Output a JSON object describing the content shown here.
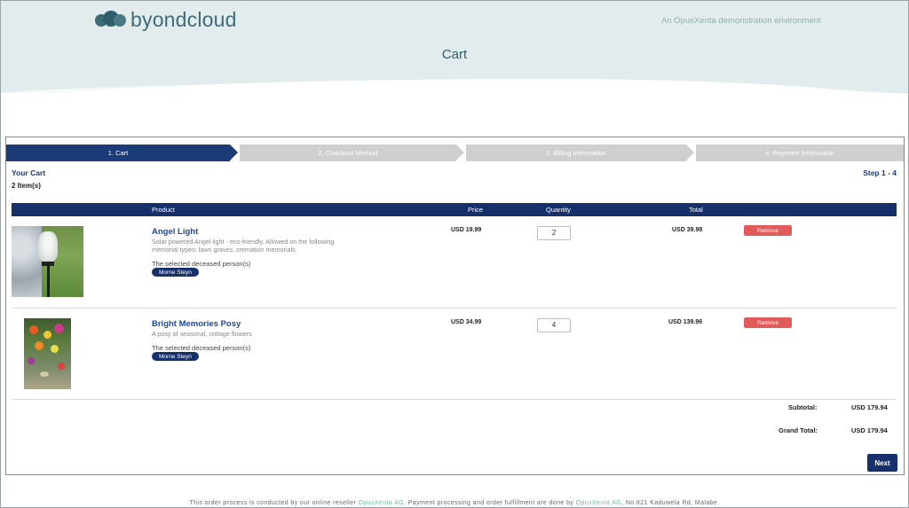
{
  "header": {
    "logo_text": "byondcloud",
    "environment_note": "An OpusXenta demonstration environment",
    "page_title": "Cart"
  },
  "steps": [
    {
      "label": "1. Cart",
      "active": true
    },
    {
      "label": "2. Checkout Method",
      "active": false
    },
    {
      "label": "3. Billing Information",
      "active": false
    },
    {
      "label": "4. Payment Information",
      "active": false
    }
  ],
  "cart": {
    "heading": "Your Cart",
    "item_count": "2 Item(s)",
    "step_range": "Step 1 - 4",
    "columns": {
      "product": "Product",
      "price": "Price",
      "quantity": "Quantity",
      "total": "Total"
    },
    "items": [
      {
        "name": "Angel Light",
        "description": "Solar powered Angel light - eco-friendly. Allowed on the following memorial types: lawn graves, cremation memorials.",
        "deceased_label": "The selected deceased person(s)",
        "deceased_name": "Morne Steyn",
        "price": "USD 19.99",
        "quantity": "2",
        "total": "USD 39.98",
        "remove_label": "Remove"
      },
      {
        "name": "Bright Memories Posy",
        "description": "A posy of seasonal, cottage flowers",
        "deceased_label": "The selected deceased person(s)",
        "deceased_name": "Morne Steyn",
        "price": "USD 34.99",
        "quantity": "4",
        "total": "USD 139.96",
        "remove_label": "Remove"
      }
    ],
    "subtotal_label": "Subtotal:",
    "subtotal_value": "USD 179.94",
    "grand_total_label": "Grand Total:",
    "grand_total_value": "USD 179.94",
    "next_label": "Next"
  },
  "footer": {
    "text_1": "This order process is conducted by our online reseller ",
    "link_1": "OpusXenta AG",
    "text_2": ". Payment processing and order fulfillment are done by ",
    "link_2": "OpusXenta AG",
    "text_3": ", No.821 Kaduwela Rd, Malabe."
  },
  "colors": {
    "primary": "#15306b",
    "header_bg": "#e2eced",
    "remove": "#e25a5a",
    "link": "#6fbf9a"
  }
}
